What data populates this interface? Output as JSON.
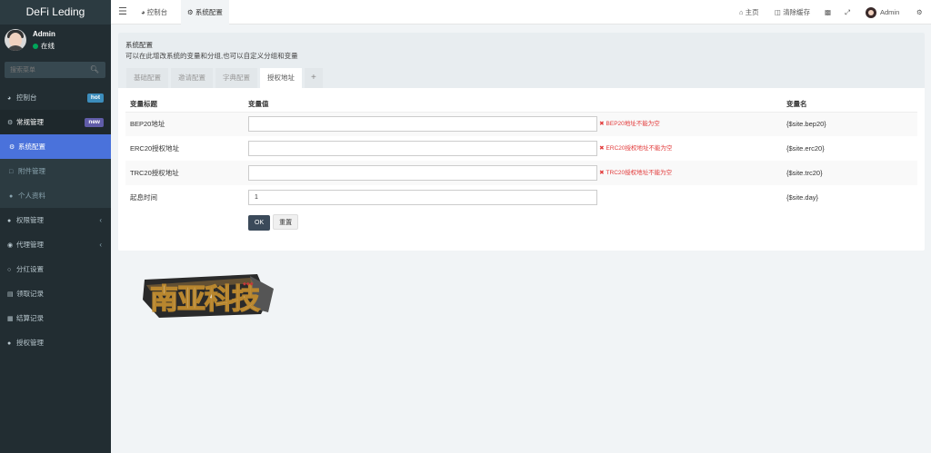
{
  "app": {
    "title": "DeFi Leding"
  },
  "user": {
    "name": "Admin",
    "status": "在线"
  },
  "search": {
    "placeholder": "搜索菜单"
  },
  "sidebar": {
    "items": [
      {
        "label": "控制台",
        "badge": "hot",
        "badge_color": "#3c8dbc"
      },
      {
        "label": "常规管理",
        "badge": "new",
        "badge_color": "#605ca8"
      },
      {
        "label": "系统配置"
      },
      {
        "label": "附件管理"
      },
      {
        "label": "个人资料"
      },
      {
        "label": "权限管理"
      },
      {
        "label": "代理管理"
      },
      {
        "label": "分红设置"
      },
      {
        "label": "领取记录"
      },
      {
        "label": "结算记录"
      },
      {
        "label": "授权管理"
      }
    ]
  },
  "navbar": {
    "tabs": [
      {
        "label": "控制台"
      },
      {
        "label": "系统配置"
      }
    ],
    "home": "主页",
    "clear_cache": "清除缓存",
    "user": "Admin"
  },
  "page": {
    "title": "系统配置",
    "description": "可以在此增改系统的变量和分组,也可以自定义分组和变量",
    "tabs": [
      {
        "label": "基础配置"
      },
      {
        "label": "邀请配置"
      },
      {
        "label": "字典配置"
      },
      {
        "label": "授权地址"
      },
      {
        "label": "+"
      }
    ]
  },
  "table": {
    "headers": {
      "title": "变量标题",
      "value": "变量值",
      "name": "变量名"
    },
    "rows": [
      {
        "title": "BEP20地址",
        "value": "",
        "error": "BEP20地址不能为空",
        "name": "{$site.bep20}"
      },
      {
        "title": "ERC20授权地址",
        "value": "",
        "error": "ERC20授权地址不能为空",
        "name": "{$site.erc20}"
      },
      {
        "title": "TRC20授权地址",
        "value": "",
        "error": "TRC20授权地址不能为空",
        "name": "{$site.trc20}"
      },
      {
        "title": "起息时间",
        "value": "1",
        "error": "",
        "name": "{$site.day}"
      }
    ],
    "ok_label": "OK",
    "reset_label": "重置"
  },
  "brand_logo": {
    "text": "南亚科技"
  },
  "colors": {
    "sidebar_bg": "#222d32",
    "active": "#4a72db",
    "error": "#e23b3b"
  }
}
